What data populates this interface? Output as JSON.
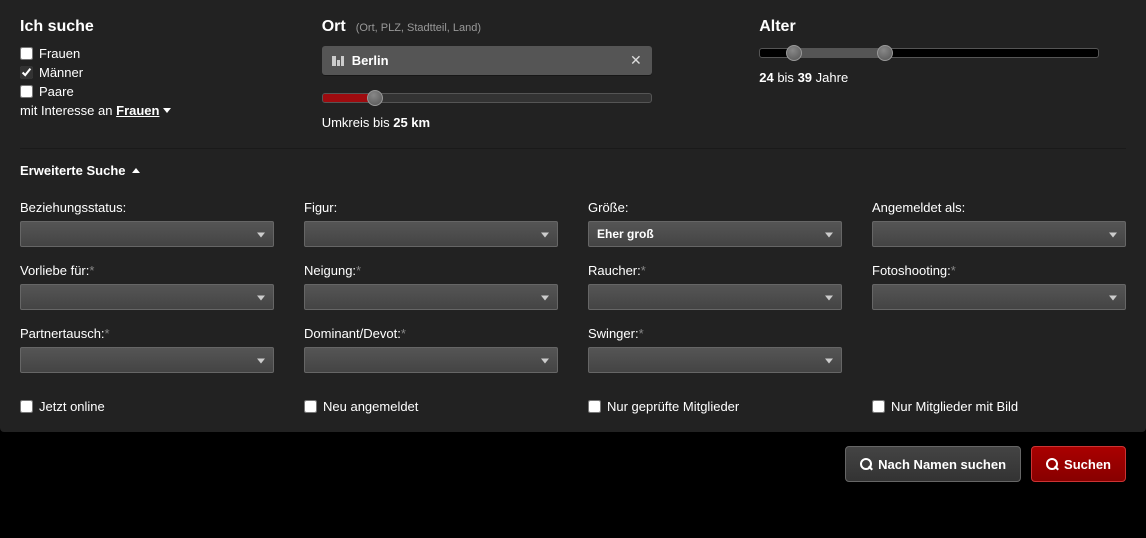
{
  "search_for": {
    "heading": "Ich suche",
    "options": [
      {
        "label": "Frauen",
        "checked": false
      },
      {
        "label": "Männer",
        "checked": true
      },
      {
        "label": "Paare",
        "checked": false
      }
    ],
    "interest_prefix": "mit Interesse an",
    "interest_value": "Frauen"
  },
  "location": {
    "heading": "Ort",
    "hint": "(Ort, PLZ, Stadtteil, Land)",
    "tag": "Berlin",
    "radius_prefix": "Umkreis bis",
    "radius_value": "25 km",
    "radius_pct": 16
  },
  "age": {
    "heading": "Alter",
    "from": "24",
    "sep": "bis",
    "to": "39",
    "suffix": "Jahre",
    "from_pct": 10,
    "to_pct": 37
  },
  "advanced": {
    "heading": "Erweiterte Suche",
    "fields": [
      {
        "label": "Beziehungsstatus:",
        "ast": false,
        "value": ""
      },
      {
        "label": "Figur:",
        "ast": false,
        "value": ""
      },
      {
        "label": "Größe:",
        "ast": false,
        "value": "Eher groß"
      },
      {
        "label": "Angemeldet als:",
        "ast": false,
        "value": ""
      },
      {
        "label": "Vorliebe für:",
        "ast": true,
        "value": ""
      },
      {
        "label": "Neigung:",
        "ast": true,
        "value": ""
      },
      {
        "label": "Raucher:",
        "ast": true,
        "value": ""
      },
      {
        "label": "Fotoshooting:",
        "ast": true,
        "value": ""
      },
      {
        "label": "Partnertausch:",
        "ast": true,
        "value": ""
      },
      {
        "label": "Dominant/Devot:",
        "ast": true,
        "value": ""
      },
      {
        "label": "Swinger:",
        "ast": true,
        "value": ""
      }
    ],
    "checks": [
      {
        "label": "Jetzt online",
        "checked": false
      },
      {
        "label": "Neu angemeldet",
        "checked": false
      },
      {
        "label": "Nur geprüfte Mitglieder",
        "checked": false
      },
      {
        "label": "Nur Mitglieder mit Bild",
        "checked": false
      }
    ]
  },
  "buttons": {
    "name_search": "Nach Namen suchen",
    "search": "Suchen"
  }
}
